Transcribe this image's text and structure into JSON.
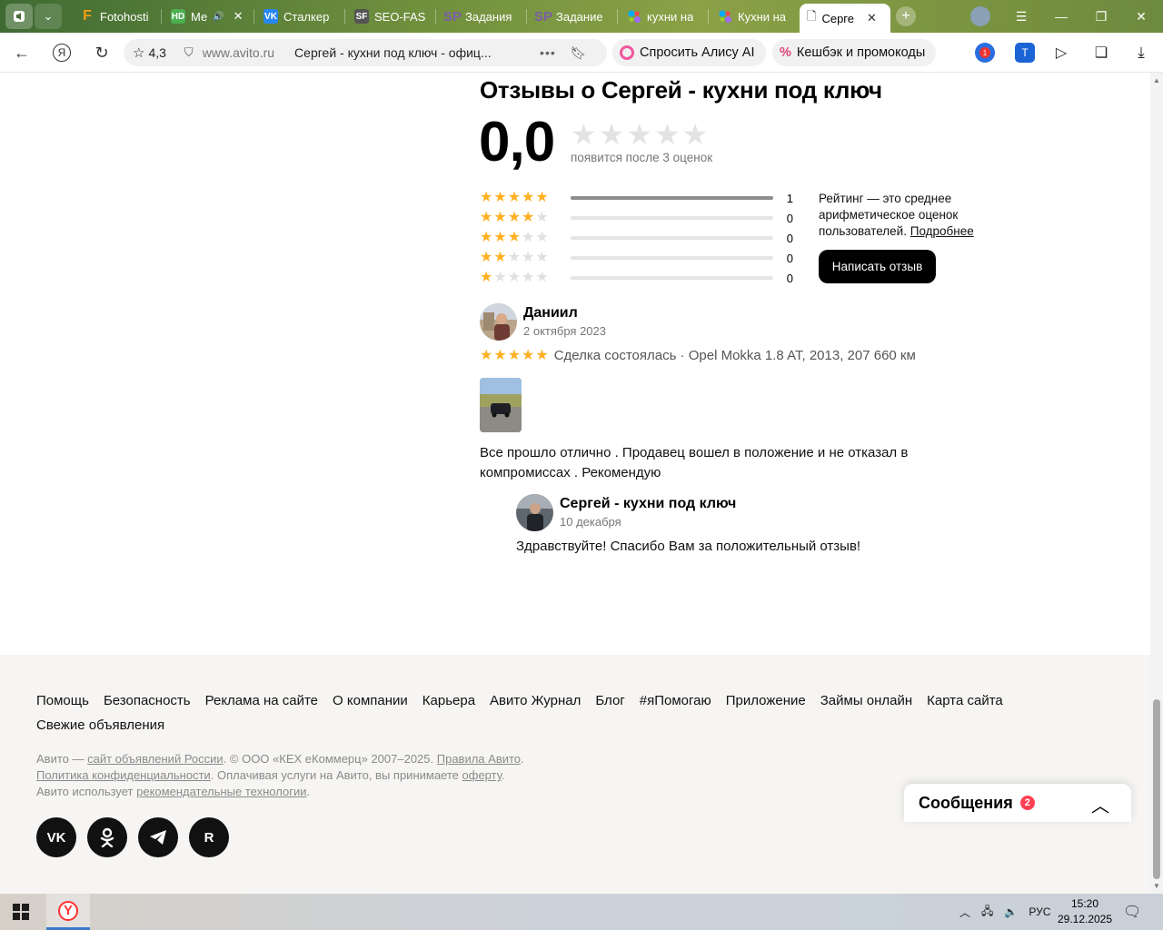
{
  "browser": {
    "tabs": [
      {
        "label": "",
        "icon": "sound-icon",
        "color": "#4a6a3a"
      },
      {
        "label": "Fotohosti",
        "icon": "fotohost-favicon",
        "color": "#f39c12"
      },
      {
        "label": "Ме",
        "icon": "hd-favicon",
        "color": "#4caf50"
      },
      {
        "label": "Сталкер",
        "icon": "vk-favicon",
        "color": "#2787f5"
      },
      {
        "label": "SEO-FAS",
        "icon": "sf-favicon",
        "color": "#555555"
      },
      {
        "label": "Задания",
        "icon": "sp-favicon",
        "color": "#7b5ea7"
      },
      {
        "label": "Задание",
        "icon": "sp-favicon",
        "color": "#7b5ea7"
      },
      {
        "label": "кухни на",
        "icon": "avito-favicon",
        "color": "#00aaff"
      },
      {
        "label": "Кухни на",
        "icon": "avito-favicon",
        "color": "#00aaff"
      },
      {
        "label": "Серге",
        "icon": "document-icon",
        "color": "#ffffff"
      }
    ],
    "address": {
      "rating": "4,3",
      "domain": "www.avito.ru",
      "page_title": "Сергей - кухни под ключ - офиц..."
    },
    "alice_label": "Спросить Алису AI",
    "cashback_label": "Кешбэк и промокоды"
  },
  "reviews": {
    "title": "Отзывы о Сергей - кухни под ключ",
    "score": "0,0",
    "score_note": "появится после 3 оценок",
    "distribution": [
      {
        "stars": 5,
        "count": "1",
        "share": 1.0
      },
      {
        "stars": 4,
        "count": "0",
        "share": 0
      },
      {
        "stars": 3,
        "count": "0",
        "share": 0
      },
      {
        "stars": 2,
        "count": "0",
        "share": 0
      },
      {
        "stars": 1,
        "count": "0",
        "share": 0
      }
    ],
    "rating_note": "Рейтинг — это среднее арифметическое оценок пользователей.",
    "more_link": "Подробнее",
    "write_button": "Написать отзыв",
    "items": [
      {
        "author": "Даниил",
        "date": "2 октября 2023",
        "stars": 5,
        "deal": "Сделка состоялась · Opel Mokka 1.8 AT, 2013, 207 660 км",
        "text": "Все прошло отлично . Продавец вошел в положение и не отказал в компромиссах . Рекомендую",
        "reply": {
          "author": "Сергей - кухни под ключ",
          "date": "10 декабря",
          "text": "Здравствуйте! Спасибо Вам за положительный отзыв!"
        }
      }
    ]
  },
  "footer": {
    "links": [
      "Помощь",
      "Безопасность",
      "Реклама на сайте",
      "О компании",
      "Карьера",
      "Авито Журнал",
      "Блог",
      "#яПомогаю",
      "Приложение",
      "Займы онлайн",
      "Карта сайта",
      "Свежие объявления"
    ],
    "legal": {
      "p1": "Авито — ",
      "l1": "сайт объявлений России",
      "p2": ". © ООО «КЕХ еКоммерц» 2007–2025. ",
      "l2": "Правила Авито",
      "p3": ".",
      "l3": "Политика конфиденциальности",
      "p4": ". Оплачивая услуги на Авито, вы принимаете ",
      "l4": "оферту",
      "p5": ".",
      "p6": "Авито использует ",
      "l5": "рекомендательные технологии",
      "p7": "."
    },
    "socials": [
      "vk-icon",
      "odnoklassniki-icon",
      "telegram-icon",
      "rutube-icon"
    ]
  },
  "messages": {
    "label": "Сообщения",
    "count": "2"
  },
  "taskbar": {
    "lang": "РУС",
    "time": "15:20",
    "date": "29.12.2025"
  },
  "colors": {
    "star": "#ffb021",
    "badge": "#ff4053",
    "footer_bg": "#f6f5f3"
  }
}
